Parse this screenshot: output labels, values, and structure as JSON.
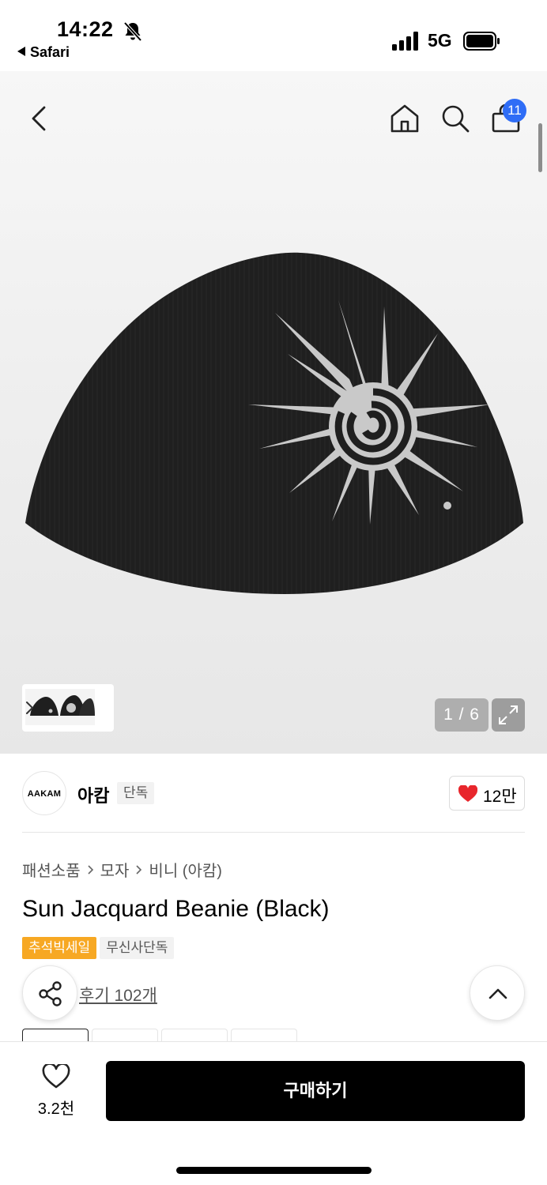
{
  "status_bar": {
    "time": "14:22",
    "back_app": "Safari",
    "network": "5G"
  },
  "nav": {
    "cart_count": "11"
  },
  "gallery": {
    "counter": "1 / 6"
  },
  "brand": {
    "logo_text": "AAKAM",
    "name": "아캄",
    "tag": "단독",
    "likes": "12만"
  },
  "product": {
    "breadcrumb": [
      "패션소품",
      "모자",
      "비니 (아캄)"
    ],
    "title": "Sun Jacquard Beanie (Black)",
    "badges": [
      "추석빅세일",
      "무신사단독"
    ],
    "reviews": "후기 102개"
  },
  "bottom": {
    "wish_count": "3.2천",
    "buy_label": "구매하기"
  },
  "colors": {
    "accent_blue": "#2f6df6",
    "sale_orange": "#f7a823",
    "heart_red": "#e8262c"
  }
}
